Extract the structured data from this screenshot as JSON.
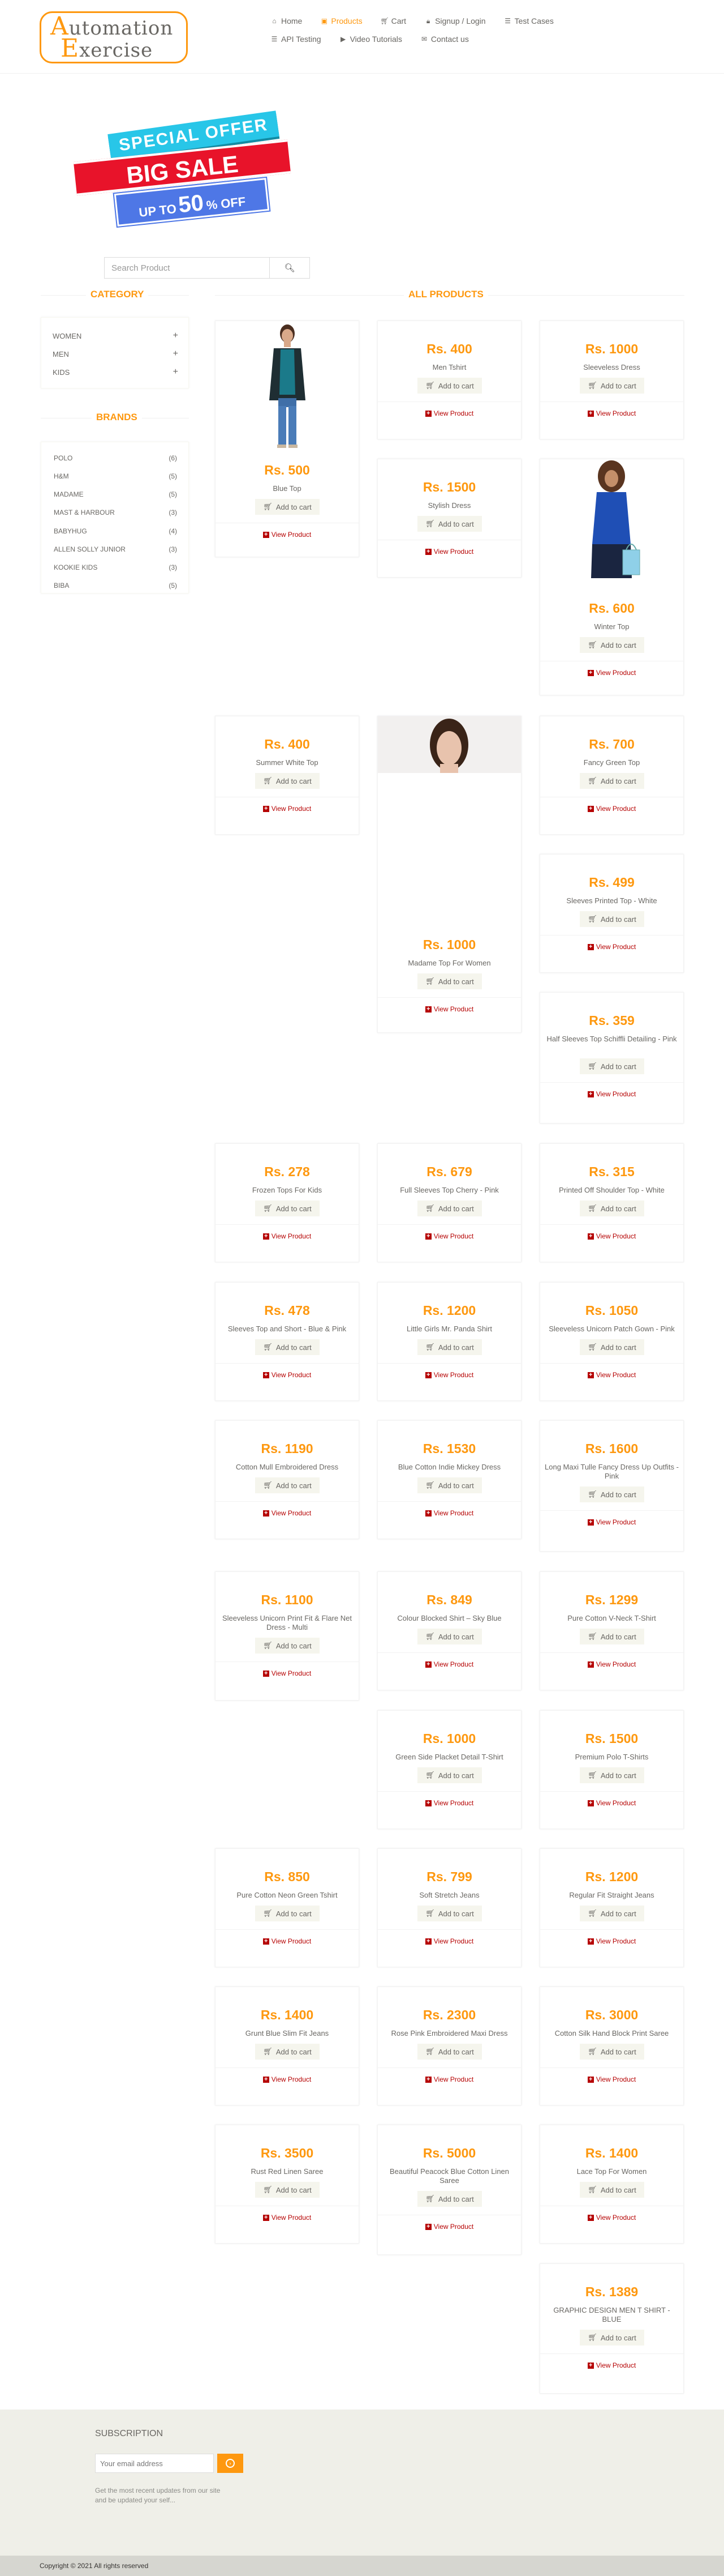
{
  "header": {
    "logo_line1": "Automation",
    "logo_line2": "Exercise",
    "nav": [
      {
        "label": "Home",
        "icon": "home-icon"
      },
      {
        "label": "Products",
        "icon": "products-icon",
        "active": true
      },
      {
        "label": "Cart",
        "icon": "cart-icon"
      },
      {
        "label": "Signup / Login",
        "icon": "lock-icon"
      },
      {
        "label": "Test Cases",
        "icon": "list-icon"
      },
      {
        "label": "API Testing",
        "icon": "list-icon"
      },
      {
        "label": "Video Tutorials",
        "icon": "youtube-icon"
      },
      {
        "label": "Contact us",
        "icon": "envelope-icon"
      }
    ]
  },
  "banner": {
    "line1": "SPECIAL OFFER",
    "line2": "BIG SALE",
    "line3_small": "UP TO",
    "line3_big": "50",
    "line3_suffix": "% OFF"
  },
  "search": {
    "placeholder": "Search Product"
  },
  "sidebar": {
    "category_title": "Category",
    "categories": [
      "Women",
      "Men",
      "Kids"
    ],
    "brands_title": "Brands",
    "brands": [
      {
        "name": "Polo",
        "count": "(6)"
      },
      {
        "name": "H&M",
        "count": "(5)"
      },
      {
        "name": "Madame",
        "count": "(5)"
      },
      {
        "name": "Mast & Harbour",
        "count": "(3)"
      },
      {
        "name": "Babyhug",
        "count": "(4)"
      },
      {
        "name": "Allen Solly Junior",
        "count": "(3)"
      },
      {
        "name": "Kookie Kids",
        "count": "(3)"
      },
      {
        "name": "Biba",
        "count": "(5)"
      }
    ]
  },
  "main": {
    "title": "All Products",
    "add_to_cart_label": "Add to cart",
    "view_product_label": "View Product",
    "products": [
      {
        "price": "Rs. 500",
        "name": "Blue Top"
      },
      {
        "price": "Rs. 400",
        "name": "Men Tshirt"
      },
      {
        "price": "Rs. 1000",
        "name": "Sleeveless Dress"
      },
      {
        "price": "Rs. 1500",
        "name": "Stylish Dress"
      },
      {
        "price": "Rs. 600",
        "name": "Winter Top"
      },
      {
        "price": "Rs. 400",
        "name": "Summer White Top"
      },
      {
        "price": "Rs. 1000",
        "name": "Madame Top For Women"
      },
      {
        "price": "Rs. 700",
        "name": "Fancy Green Top"
      },
      {
        "price": "Rs. 499",
        "name": "Sleeves Printed Top - White"
      },
      {
        "price": "Rs. 359",
        "name": "Half Sleeves Top Schiffli Detailing - Pink"
      },
      {
        "price": "Rs. 278",
        "name": "Frozen Tops For Kids"
      },
      {
        "price": "Rs. 679",
        "name": "Full Sleeves Top Cherry - Pink"
      },
      {
        "price": "Rs. 315",
        "name": "Printed Off Shoulder Top - White"
      },
      {
        "price": "Rs. 478",
        "name": "Sleeves Top and Short - Blue & Pink"
      },
      {
        "price": "Rs. 1200",
        "name": "Little Girls Mr. Panda Shirt"
      },
      {
        "price": "Rs. 1050",
        "name": "Sleeveless Unicorn Patch Gown - Pink"
      },
      {
        "price": "Rs. 1190",
        "name": "Cotton Mull Embroidered Dress"
      },
      {
        "price": "Rs. 1530",
        "name": "Blue Cotton Indie Mickey Dress"
      },
      {
        "price": "Rs. 1600",
        "name": "Long Maxi Tulle Fancy Dress Up Outfits -Pink"
      },
      {
        "price": "Rs. 1100",
        "name": "Sleeveless Unicorn Print Fit & Flare Net Dress - Multi"
      },
      {
        "price": "Rs. 849",
        "name": "Colour Blocked Shirt – Sky Blue"
      },
      {
        "price": "Rs. 1299",
        "name": "Pure Cotton V-Neck T-Shirt"
      },
      {
        "price": "Rs. 1000",
        "name": "Green Side Placket Detail T-Shirt"
      },
      {
        "price": "Rs. 1500",
        "name": "Premium Polo T-Shirts"
      },
      {
        "price": "Rs. 850",
        "name": "Pure Cotton Neon Green Tshirt"
      },
      {
        "price": "Rs. 799",
        "name": "Soft Stretch Jeans"
      },
      {
        "price": "Rs. 1200",
        "name": "Regular Fit Straight Jeans"
      },
      {
        "price": "Rs. 1400",
        "name": "Grunt Blue Slim Fit Jeans"
      },
      {
        "price": "Rs. 2300",
        "name": "Rose Pink Embroidered Maxi Dress"
      },
      {
        "price": "Rs. 3000",
        "name": "Cotton Silk Hand Block Print Saree"
      },
      {
        "price": "Rs. 3500",
        "name": "Rust Red Linen Saree"
      },
      {
        "price": "Rs. 5000",
        "name": "Beautiful Peacock Blue Cotton Linen Saree"
      },
      {
        "price": "Rs. 1400",
        "name": "Lace Top For Women"
      },
      {
        "price": "Rs. 1389",
        "name": "GRAPHIC DESIGN MEN T SHIRT - BLUE"
      }
    ]
  },
  "footer": {
    "subscription_title": "Subscription",
    "email_placeholder": "Your email address",
    "note": "Get the most recent updates from our site and be updated your self...",
    "copyright": "Copyright © 2021 All rights reserved"
  },
  "colors": {
    "accent": "#FE980F",
    "text": "#696763",
    "view_link": "#B50000",
    "footer_bg": "#EFEFE8"
  }
}
